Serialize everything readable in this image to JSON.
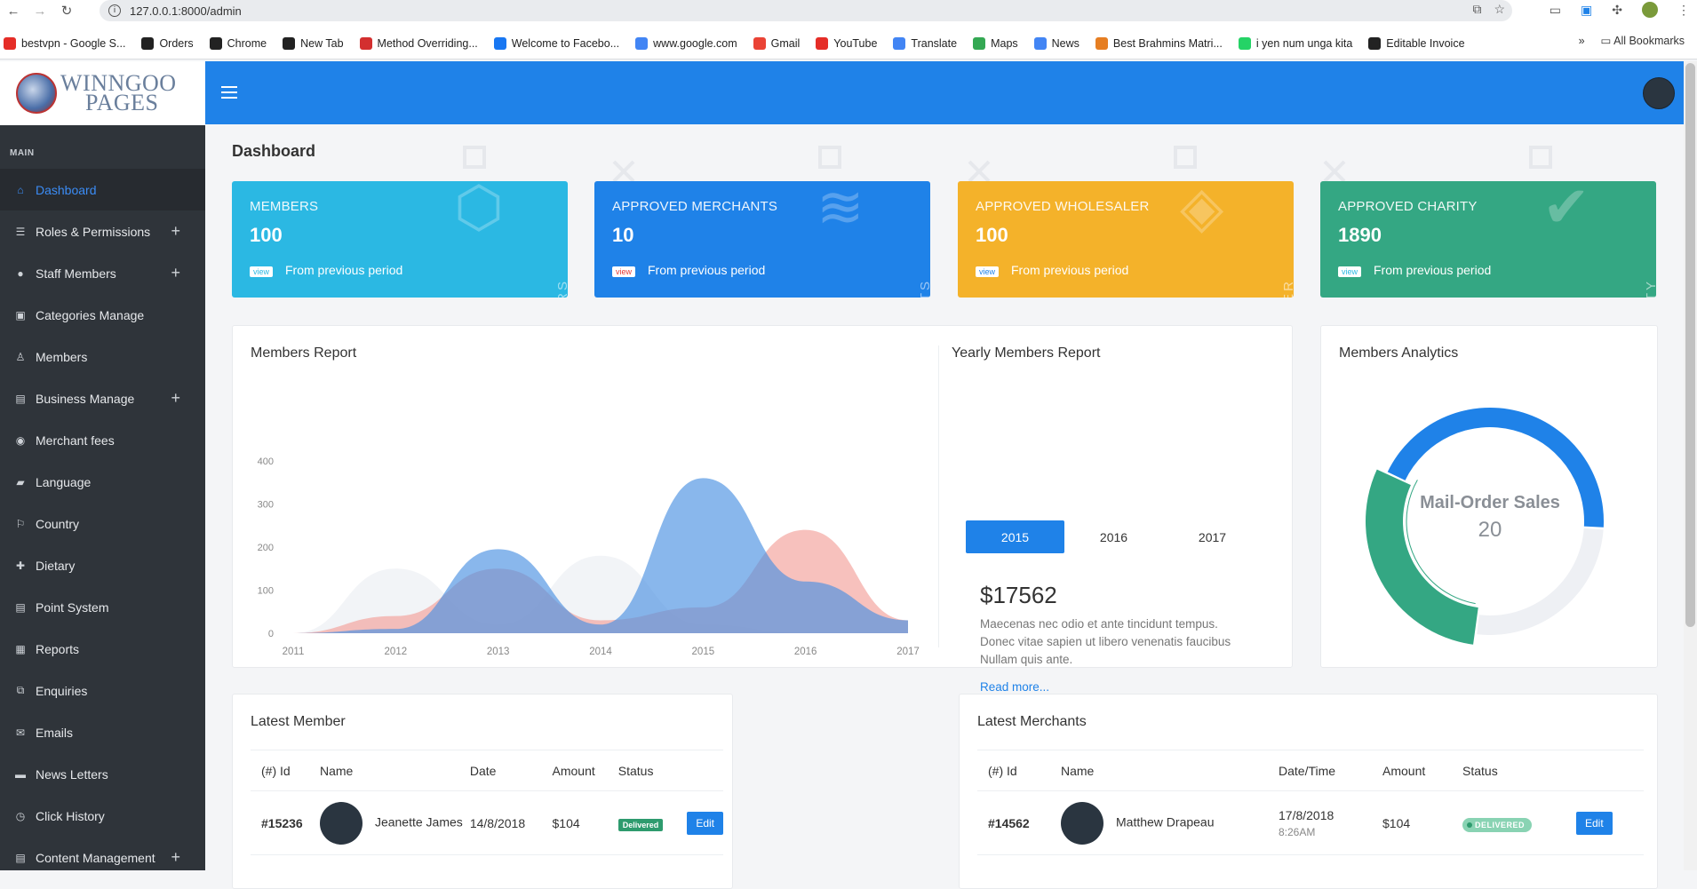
{
  "browser": {
    "url": "127.0.0.1:8000/admin",
    "bookmarks": [
      {
        "label": "bestvpn - Google S...",
        "color": "#e52d27"
      },
      {
        "label": "Orders",
        "color": "#222"
      },
      {
        "label": "Chrome",
        "color": "#222"
      },
      {
        "label": "New Tab",
        "color": "#222"
      },
      {
        "label": "Method Overriding...",
        "color": "#d32f2f"
      },
      {
        "label": "Welcome to Facebo...",
        "color": "#1877f2"
      },
      {
        "label": "www.google.com",
        "color": "#4285f4"
      },
      {
        "label": "Gmail",
        "color": "#ea4335"
      },
      {
        "label": "YouTube",
        "color": "#e52d27"
      },
      {
        "label": "Translate",
        "color": "#4285f4"
      },
      {
        "label": "Maps",
        "color": "#34a853"
      },
      {
        "label": "News",
        "color": "#4285f4"
      },
      {
        "label": "Best Brahmins Matri...",
        "color": "#e67e22"
      },
      {
        "label": "i yen num unga kita",
        "color": "#25d366"
      },
      {
        "label": "Editable Invoice",
        "color": "#222"
      }
    ],
    "all_bookmarks": "All Bookmarks",
    "more": "»"
  },
  "logo": {
    "line1": "WINNGOO",
    "line2": "PAGES"
  },
  "sidebar": {
    "section": "MAIN",
    "items": [
      {
        "label": "Dashboard",
        "icon": "home-icon",
        "glyph": "⌂",
        "plus": false,
        "active": true
      },
      {
        "label": "Roles & Permissions",
        "icon": "list-icon",
        "glyph": "☰",
        "plus": true
      },
      {
        "label": "Staff Members",
        "icon": "user-icon",
        "glyph": "●",
        "plus": true
      },
      {
        "label": "Categories Manage",
        "icon": "image-icon",
        "glyph": "▣",
        "plus": false
      },
      {
        "label": "Members",
        "icon": "members-icon",
        "glyph": "♙",
        "plus": false
      },
      {
        "label": "Business Manage",
        "icon": "document-icon",
        "glyph": "▤",
        "plus": true
      },
      {
        "label": "Merchant fees",
        "icon": "coin-icon",
        "glyph": "◉",
        "plus": false
      },
      {
        "label": "Language",
        "icon": "language-icon",
        "glyph": "▰",
        "plus": false
      },
      {
        "label": "Country",
        "icon": "flag-icon",
        "glyph": "⚐",
        "plus": false
      },
      {
        "label": "Dietary",
        "icon": "dietary-icon",
        "glyph": "✚",
        "plus": false
      },
      {
        "label": "Point System",
        "icon": "points-icon",
        "glyph": "▤",
        "plus": false
      },
      {
        "label": "Reports",
        "icon": "reports-icon",
        "glyph": "▦",
        "plus": false
      },
      {
        "label": "Enquiries",
        "icon": "enquiries-icon",
        "glyph": "⧉",
        "plus": false
      },
      {
        "label": "Emails",
        "icon": "mail-icon",
        "glyph": "✉",
        "plus": false
      },
      {
        "label": "News Letters",
        "icon": "newsletter-icon",
        "glyph": "▬",
        "plus": false
      },
      {
        "label": "Click History",
        "icon": "history-icon",
        "glyph": "◷",
        "plus": false
      },
      {
        "label": "Content Management",
        "icon": "content-icon",
        "glyph": "▤",
        "plus": true
      }
    ]
  },
  "page": {
    "title": "Dashboard"
  },
  "cards": [
    {
      "title": "MEMBERS",
      "value": "100",
      "view": "view",
      "footer": "From previous period",
      "vlabel": "MEMBERS",
      "color": "#2bb8e3",
      "view_color": "#2bb8e3",
      "icon": "cube-icon",
      "glyph": "⬡"
    },
    {
      "title": "APPROVED MERCHANTS",
      "value": "10",
      "view": "view",
      "footer": "From previous period",
      "vlabel": "MERCHANTS",
      "color": "#1f82e8",
      "view_color": "#e53935",
      "icon": "layers-icon",
      "glyph": "≋"
    },
    {
      "title": "APPROVED WHOLESALER",
      "value": "100",
      "view": "view",
      "footer": "From previous period",
      "vlabel": "WHOLESALER",
      "color": "#f4b22a",
      "view_color": "#1f82e8",
      "icon": "tag-icon",
      "glyph": "◈"
    },
    {
      "title": "APPROVED CHARITY",
      "value": "1890",
      "view": "view",
      "footer": "From previous period",
      "vlabel": "CHARITY",
      "color": "#34a783",
      "view_color": "#2bb8e3",
      "icon": "check-icon",
      "glyph": "✔"
    }
  ],
  "members_report": {
    "title": "Members Report"
  },
  "chart_data": {
    "type": "area",
    "title": "Members Report",
    "categories": [
      "2011",
      "2012",
      "2013",
      "2014",
      "2015",
      "2016",
      "2017"
    ],
    "ylim": [
      0,
      400
    ],
    "yticks": [
      0,
      100,
      200,
      300,
      400
    ],
    "series": [
      {
        "values": [
          0,
          150,
          20,
          180,
          20,
          0,
          0
        ],
        "color": "#e9ecf1"
      },
      {
        "values": [
          0,
          40,
          150,
          30,
          60,
          240,
          30
        ],
        "color": "#f2a09a"
      },
      {
        "values": [
          0,
          10,
          195,
          20,
          360,
          120,
          30
        ],
        "color": "#4a90e2"
      }
    ],
    "grid": false
  },
  "yearly": {
    "title": "Yearly Members Report",
    "tabs": [
      "2015",
      "2016",
      "2017"
    ],
    "value": "$17562",
    "text": "Maecenas nec odio et ante tincidunt tempus. Donec vitae sapien ut libero venenatis faucibus Nullam quis ante.",
    "read_more": "Read more..."
  },
  "analytics": {
    "title": "Members Analytics",
    "center_label": "Mail-Order Sales",
    "center_value": "20",
    "segments": [
      {
        "fraction": 0.44,
        "color": "#1f82e8"
      },
      {
        "fraction": 0.26,
        "color": "#eef0f4"
      },
      {
        "fraction": 0.3,
        "color": "#34a783"
      }
    ]
  },
  "latest_member": {
    "title": "Latest Member",
    "headers": [
      "(#) Id",
      "Name",
      "Date",
      "Amount",
      "Status"
    ],
    "rows": [
      {
        "id": "#15236",
        "name": "Jeanette James",
        "date": "14/8/2018",
        "amount": "$104",
        "status": "Delivered",
        "edit": "Edit"
      }
    ]
  },
  "latest_merchants": {
    "title": "Latest Merchants",
    "headers": [
      "(#) Id",
      "Name",
      "Date/Time",
      "Amount",
      "Status"
    ],
    "rows": [
      {
        "id": "#14562",
        "name": "Matthew Drapeau",
        "date": "17/8/2018",
        "time": "8:26AM",
        "amount": "$104",
        "status": "DELIVERED",
        "edit": "Edit"
      }
    ]
  }
}
